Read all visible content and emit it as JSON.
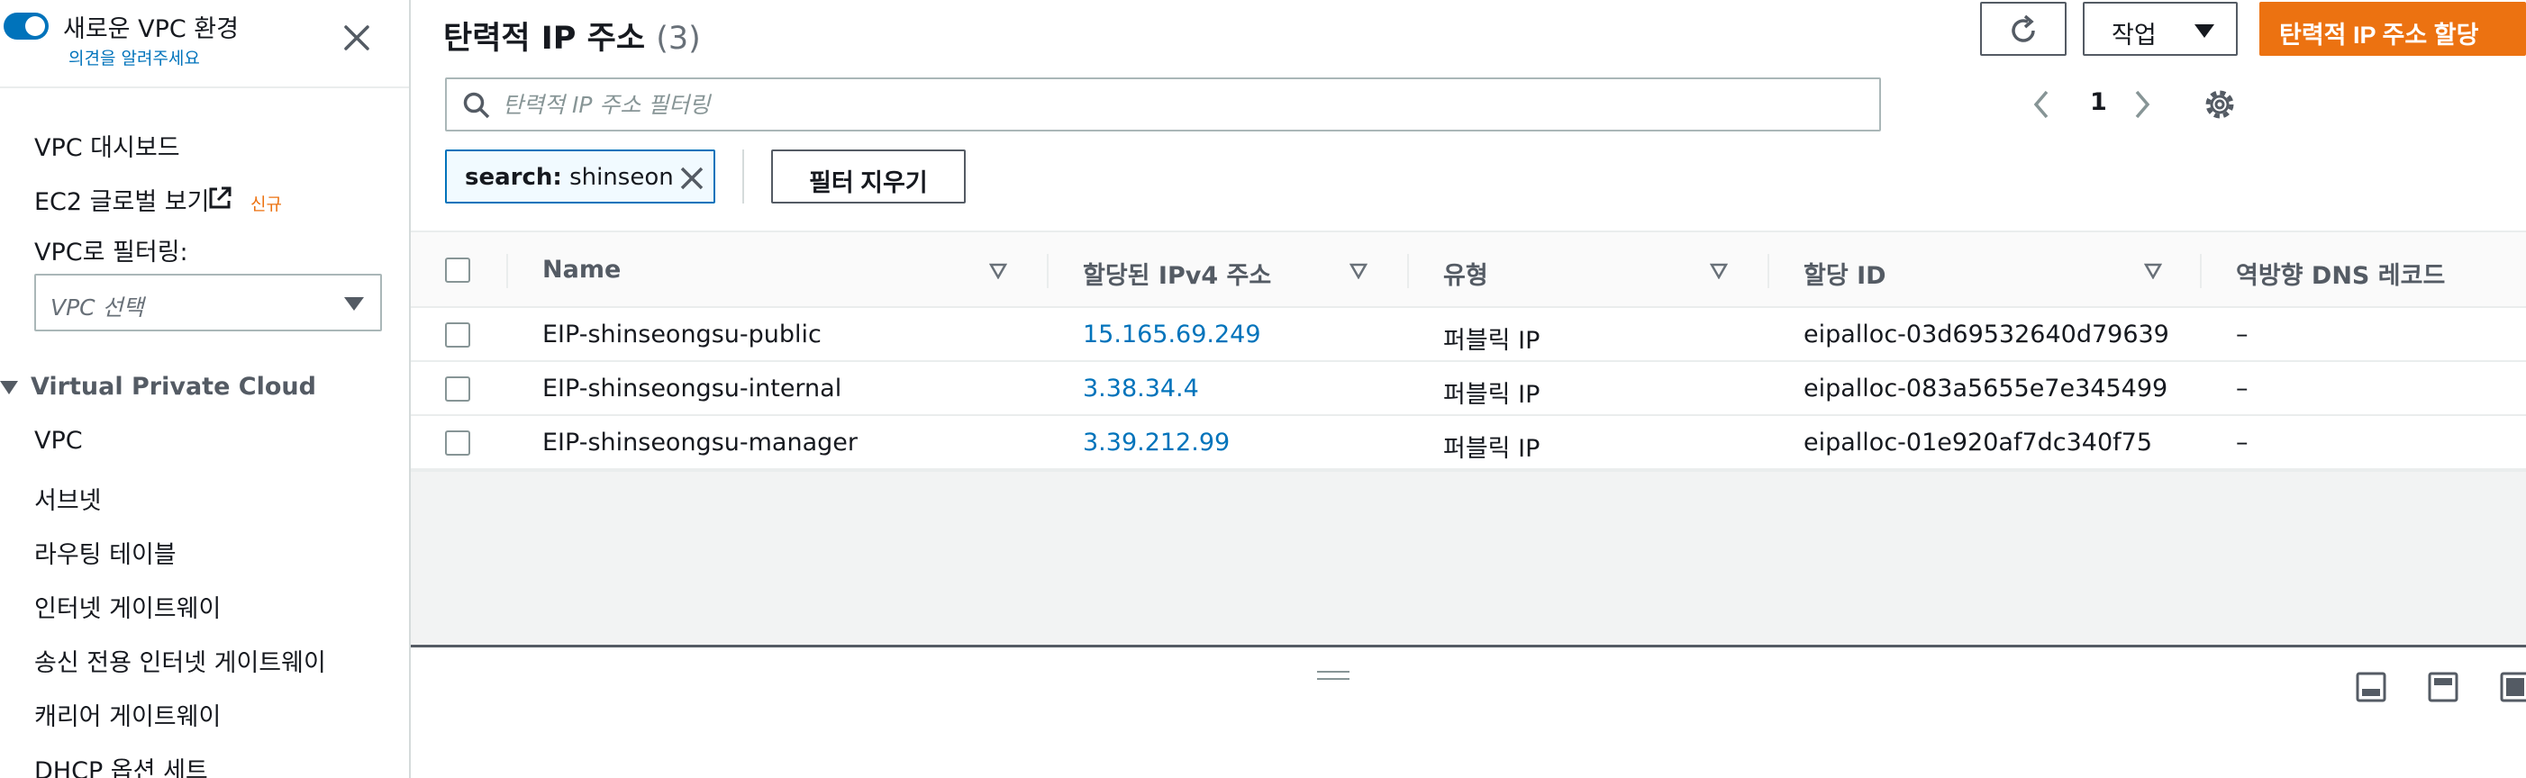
{
  "sidebar": {
    "title": "새로운 VPC 환경",
    "feedback_link": "의견을 알려주세요",
    "nav_top": [
      {
        "label": "VPC 대시보드"
      },
      {
        "label": "EC2 글로벌 보기"
      }
    ],
    "new_badge": "신규",
    "filter_label": "VPC로 필터링:",
    "vpc_select_placeholder": "VPC 선택",
    "section_title": "Virtual Private Cloud",
    "section_items": [
      {
        "label": "VPC"
      },
      {
        "label": "서브넷"
      },
      {
        "label": "라우팅 테이블"
      },
      {
        "label": "인터넷 게이트웨이"
      },
      {
        "label": "송신 전용 인터넷 게이트웨이"
      },
      {
        "label": "캐리어 게이트웨이"
      },
      {
        "label": "DHCP 옵션 세트"
      }
    ]
  },
  "main": {
    "title": "탄력적 IP 주소",
    "count": "(3)",
    "actions_label": "작업",
    "primary_button": "탄력적 IP 주소 할당",
    "search_placeholder": "탄력적 IP 주소 필터링",
    "page_number": "1",
    "filter_token": {
      "key": "search:",
      "value": "shinseon"
    },
    "clear_filters": "필터 지우기"
  },
  "table": {
    "columns": [
      "Name",
      "할당된 IPv4 주소",
      "유형",
      "할당 ID",
      "역방향 DNS 레코드"
    ],
    "rows": [
      {
        "name": "EIP-shinseongsu-public",
        "ip": "15.165.69.249",
        "type": "퍼블릭 IP",
        "alloc_id": "eipalloc-03d69532640d79639",
        "dns": "–"
      },
      {
        "name": "EIP-shinseongsu-internal",
        "ip": "3.38.34.4",
        "type": "퍼블릭 IP",
        "alloc_id": "eipalloc-083a5655e7e345499",
        "dns": "–"
      },
      {
        "name": "EIP-shinseongsu-manager",
        "ip": "3.39.212.99",
        "type": "퍼블릭 IP",
        "alloc_id": "eipalloc-01e920af7dc340f75",
        "dns": "–"
      }
    ]
  },
  "colors": {
    "link": "#0073bb",
    "primary": "#ec7211",
    "text": "#16191f",
    "muted": "#545b64"
  },
  "icons": [
    "close-icon",
    "external-link-icon",
    "refresh-icon",
    "search-icon",
    "chevron-left-icon",
    "chevron-right-icon",
    "gear-icon",
    "sort-icon",
    "panel-bottom-icon",
    "panel-side-icon"
  ]
}
